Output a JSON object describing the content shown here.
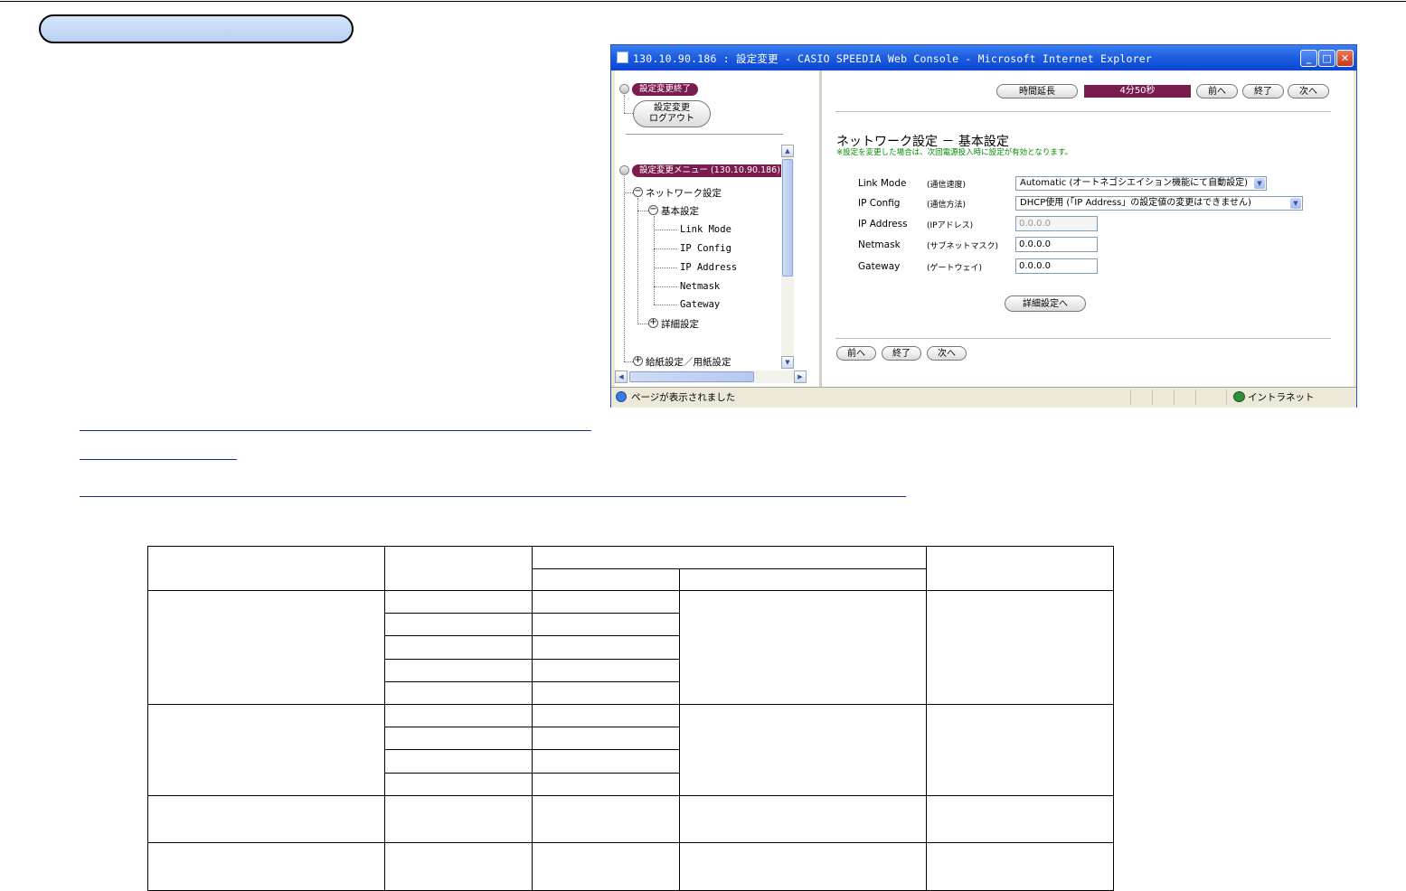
{
  "window": {
    "title": "130.10.90.186 : 設定変更 - CASIO SPEEDIA Web Console - Microsoft Internet Explorer",
    "minimize": "_",
    "maximize": "□",
    "close": "✕"
  },
  "left_pane": {
    "end_settings_label": "設定変更終了",
    "logout_button": [
      "設定変更",
      "ログアウト"
    ],
    "menu_label": "設定変更メニュー (130.10.90.186)",
    "tree": {
      "network": "ネットワーク設定",
      "basic": "基本設定",
      "items": [
        "Link Mode",
        "IP Config",
        "IP Address",
        "Netmask",
        "Gateway"
      ],
      "detail": "詳細設定",
      "paper": "給紙設定／用紙設定"
    }
  },
  "right_pane": {
    "extend_button": "時間延長",
    "timer": "4分50秒",
    "prev_button": "前へ",
    "end_button": "終了",
    "next_button": "次へ",
    "heading": "ネットワーク設定 － 基本設定",
    "note": "※設定を変更した場合は、次回電源投入時に設定が有効となります。",
    "fields": [
      {
        "label": "Link Mode",
        "sub": "(通信速度)",
        "type": "select",
        "value": "Automatic (オートネゴシエイション機能にて自動設定)"
      },
      {
        "label": "IP Config",
        "sub": "(通信方法)",
        "type": "select",
        "value": "DHCP使用 (「IP Address」の設定値の変更はできません)"
      },
      {
        "label": "IP Address",
        "sub": "(IPアドレス)",
        "type": "input",
        "value": "0.0.0.0",
        "disabled": true
      },
      {
        "label": "Netmask",
        "sub": "(サブネットマスク)",
        "type": "input",
        "value": "0.0.0.0"
      },
      {
        "label": "Gateway",
        "sub": "(ゲートウェイ)",
        "type": "input",
        "value": "0.0.0.0"
      }
    ],
    "detail_button": "詳細設定へ"
  },
  "status_bar": {
    "text": "ページが表示されました",
    "zone": "イントラネット"
  },
  "colors": {
    "title_blue": "#0a46d2",
    "purple_tag": "#7a1c4e",
    "note_green": "#008a00",
    "pill_blue": "#b7d0f2"
  }
}
